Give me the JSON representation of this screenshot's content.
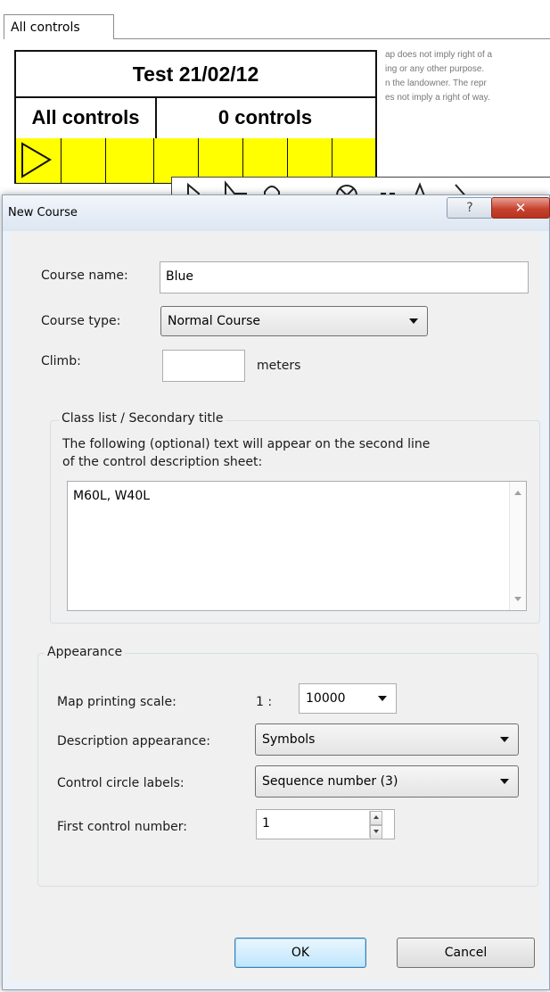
{
  "background": {
    "tab_label": "All controls",
    "sheet_title": "Test 21/02/12",
    "left_header": "All controls",
    "right_header": "0 controls",
    "disclaimer_lines": [
      "ap does not imply right of a",
      "ing or any other purpose.",
      "n the landowner. The repr",
      "es not imply a right of way."
    ]
  },
  "dialog": {
    "title": "New Course",
    "help_glyph": "?",
    "close_glyph": "✕",
    "course_name_label": "Course name:",
    "course_name_value": "Blue",
    "course_type_label": "Course type:",
    "course_type_value": "Normal Course",
    "climb_label": "Climb:",
    "climb_value": "",
    "climb_unit": "meters",
    "class_group_title": "Class list / Secondary title",
    "class_help_line1": "The following (optional) text will appear on the second line",
    "class_help_line2": "of the control description sheet:",
    "class_list_value": "M60L, W40L",
    "appearance_group_title": "Appearance",
    "scale_label": "Map printing scale:",
    "scale_prefix": "1 :",
    "scale_value": "10000",
    "desc_label": "Description appearance:",
    "desc_value": "Symbols",
    "circle_label": "Control circle labels:",
    "circle_value": "Sequence number (3)",
    "first_label": "First control number:",
    "first_value": "1",
    "ok_label": "OK",
    "cancel_label": "Cancel"
  }
}
